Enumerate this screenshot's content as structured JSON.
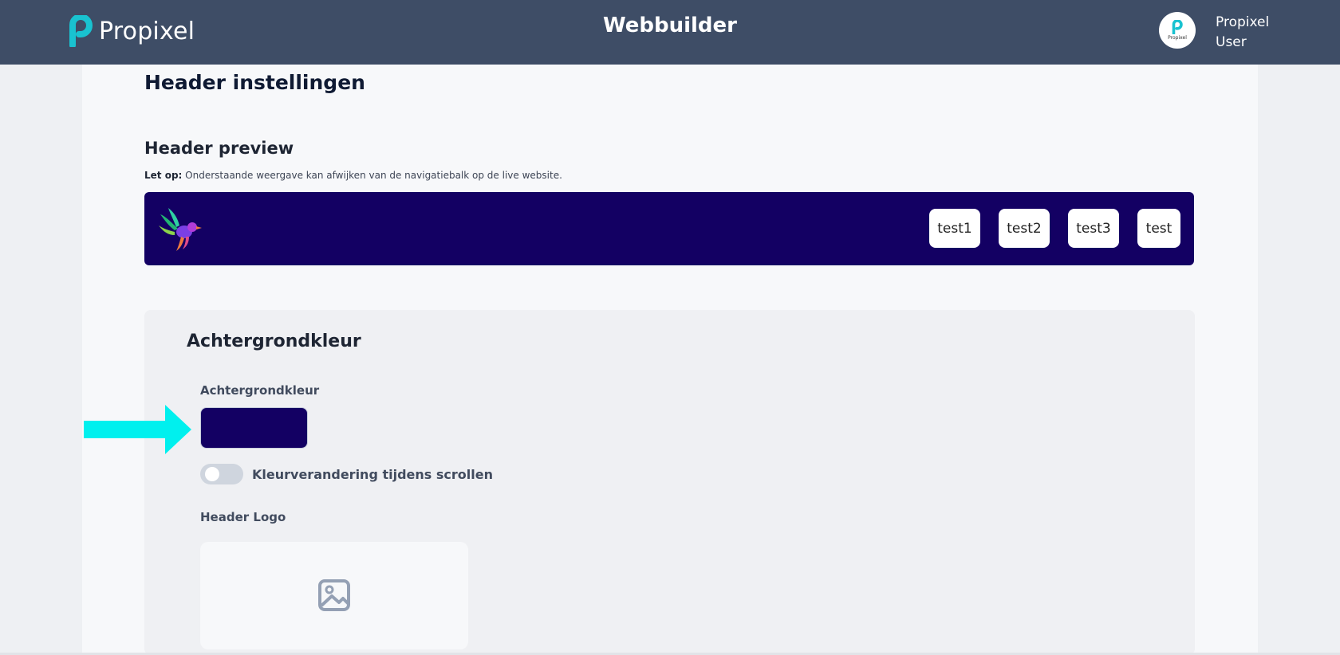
{
  "app": {
    "brand_name": "Propixel",
    "title": "Webbuilder",
    "user_first": "Propixel",
    "user_second": "User",
    "avatar_caption": "Propixel"
  },
  "page": {
    "title": "Header instellingen",
    "preview_title": "Header preview",
    "note_prefix": "Let op:",
    "note_text": " Onderstaande weergave kan afwijken van de navigatiebalk op de live website."
  },
  "preview": {
    "background_color": "#130063",
    "logo_icon": "colorful-bird-logo",
    "nav_items": [
      "test1",
      "test2",
      "test3",
      "test"
    ]
  },
  "background_section": {
    "title": "Achtergrondkleur",
    "color_label": "Achtergrondkleur",
    "color_value": "#130063",
    "scroll_toggle_label": "Kleurverandering tijdens scrollen",
    "scroll_toggle_on": false,
    "logo_label": "Header Logo",
    "logo_placeholder_icon": "image-icon"
  },
  "colors": {
    "topbar": "#3e4d66",
    "brand_accent": "#19c2d0",
    "callout_arrow": "#00f0ee"
  }
}
